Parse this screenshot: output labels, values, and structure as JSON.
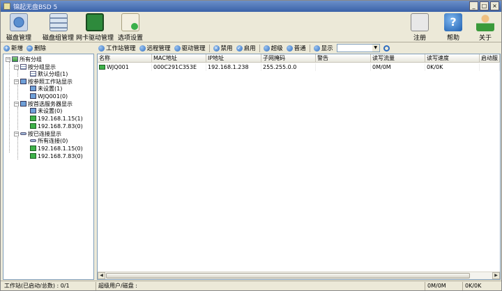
{
  "window": {
    "title": "锦起无盘BSD 5",
    "min_label": "_",
    "max_label": "□",
    "close_label": "×"
  },
  "ribbon": {
    "left": [
      {
        "label": "磁盘管理",
        "icon": "disk-icon"
      },
      {
        "label": "磁盘组管理",
        "icon": "disk-group-icon"
      },
      {
        "label": "网卡驱动管理",
        "icon": "network-card-icon"
      },
      {
        "label": "选项设置",
        "icon": "settings-clipboard-icon"
      }
    ],
    "right": [
      {
        "label": "注册",
        "icon": "register-icon"
      },
      {
        "label": "帮助",
        "icon": "help-icon",
        "glyph": "?"
      },
      {
        "label": "关于",
        "icon": "about-icon"
      }
    ]
  },
  "left_toolbar": {
    "add_label": "新增",
    "delete_label": "删除"
  },
  "main_toolbar": {
    "workstation_mgmt": "工作站管理",
    "remote_mgmt": "远程管理",
    "driver_mgmt": "驱动管理",
    "disable": "禁用",
    "enable": "启用",
    "super": "超级",
    "normal": "普通",
    "display": "显示",
    "filter_value": ""
  },
  "tree": {
    "root": "所有分组",
    "by_group": "按分组显示",
    "default_group": "默认分组(1)",
    "by_ref_ws": "按参照工作站显示",
    "unset_1": "未设置(1)",
    "wjq001": "WJQ001(0)",
    "by_server": "按首选服务器显示",
    "unset_0": "未设置(0)",
    "srv1": "192.168.1.15(1)",
    "srv2": "192.168.7.83(0)",
    "by_conn": "按已连接显示",
    "all_conn": "所有连接(0)",
    "conn1": "192.168.1.15(0)",
    "conn2": "192.168.7.83(0)"
  },
  "grid": {
    "columns": [
      "名称",
      "MAC地址",
      "IP地址",
      "子网掩码",
      "警告",
      "读写流量",
      "读写速度",
      "启动服"
    ],
    "rows": [
      {
        "name": "WJQ001",
        "mac": "000C291C353E",
        "ip": "192.168.1.238",
        "mask": "255.255.0.0",
        "warning": "",
        "traffic": "0M/0M",
        "speed": "0K/0K",
        "boot": ""
      }
    ]
  },
  "status": {
    "workstations": "工作站(已启动/总数) : 0/1",
    "super_users": "超级用户/磁盘 :",
    "traffic": "0M/0M",
    "speed": "0K/0K"
  }
}
